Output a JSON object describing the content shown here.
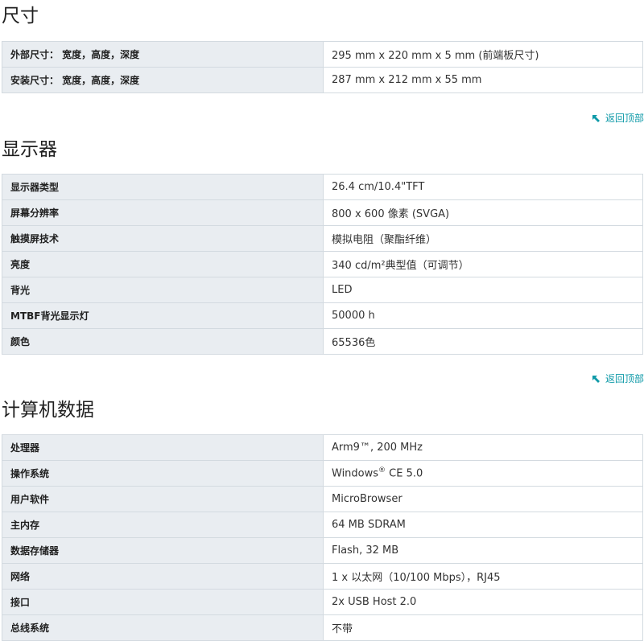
{
  "sections": [
    {
      "title": "尺寸",
      "rows": [
        {
          "label": "外部尺寸： 宽度，高度，深度",
          "value": "295 mm x 220 mm x 5 mm (前端板尺寸)"
        },
        {
          "label": "安装尺寸： 宽度，高度，深度",
          "value": "287 mm x 212 mm x 55 mm"
        }
      ],
      "back_to_top": "返回顶部"
    },
    {
      "title": "显示器",
      "rows": [
        {
          "label": "显示器类型",
          "value": "26.4 cm/10.4\"TFT"
        },
        {
          "label": "屏幕分辨率",
          "value": "800 x 600 像素 (SVGA)"
        },
        {
          "label": "触摸屏技术",
          "value": "模拟电阻（聚酯纤维）"
        },
        {
          "label": "亮度",
          "value": "340 cd/m²典型值（可调节）"
        },
        {
          "label": "背光",
          "value": "LED"
        },
        {
          "label": "MTBF背光显示灯",
          "value": "50000 h"
        },
        {
          "label": "颜色",
          "value": "65536色"
        }
      ],
      "back_to_top": "返回顶部"
    },
    {
      "title": "计算机数据",
      "rows": [
        {
          "label": "处理器",
          "value": "Arm9™, 200 MHz"
        },
        {
          "label": "操作系统",
          "value_prefix": "Windows",
          "value_sup": "®",
          "value_suffix": " CE 5.0"
        },
        {
          "label": "用户软件",
          "value": "MicroBrowser"
        },
        {
          "label": "主内存",
          "value": "64 MB SDRAM"
        },
        {
          "label": "数据存储器",
          "value": "Flash, 32 MB"
        },
        {
          "label": "网络",
          "value": "1 x 以太网（10/100 Mbps），RJ45"
        },
        {
          "label": "接口",
          "value": "2x USB Host 2.0"
        },
        {
          "label": "总线系统",
          "value": "不带"
        }
      ]
    }
  ],
  "colors": {
    "label_bg": "#e9edf1",
    "border": "#d3dae0",
    "link": "#0f9aa8"
  },
  "icons": {
    "back_to_top": "arrow-up-left-icon"
  }
}
